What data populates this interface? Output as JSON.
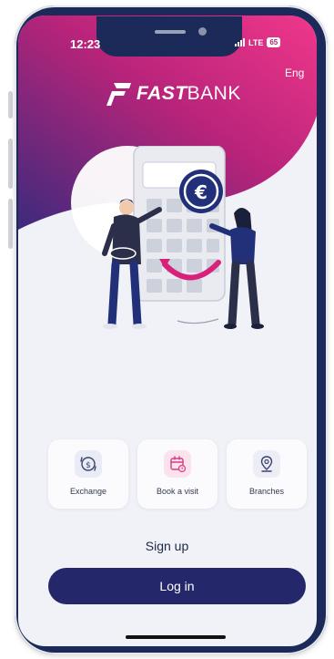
{
  "status": {
    "time": "12:23",
    "network": "LTE",
    "battery": "65"
  },
  "header": {
    "language": "Eng",
    "brand_bold": "FAST",
    "brand_regular": "BANK"
  },
  "illustration": {
    "currency_symbol": "€"
  },
  "quick_actions": [
    {
      "label": "Exchange",
      "icon": "exchange-icon"
    },
    {
      "label": "Book a visit",
      "icon": "calendar-icon"
    },
    {
      "label": "Branches",
      "icon": "location-pin-icon"
    }
  ],
  "actions": {
    "signup_label": "Sign up",
    "login_label": "Log in"
  },
  "colors": {
    "primary": "#24286b",
    "accent": "#b5226f",
    "gradient_start": "#e8348a",
    "gradient_end": "#3a2a7a",
    "frame": "#1c2a5a"
  }
}
